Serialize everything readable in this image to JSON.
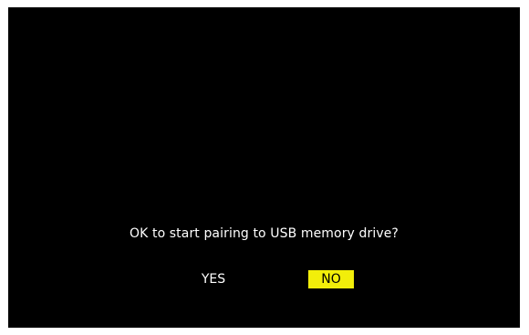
{
  "dialog": {
    "message": "OK to start pairing to USB memory drive?",
    "options": {
      "yes_label": "YES",
      "no_label": "NO"
    },
    "selected_option": "NO"
  },
  "colors": {
    "background": "#000000",
    "text": "#ffffff",
    "highlight": "#f2ee0a",
    "highlight_text": "#000000"
  }
}
